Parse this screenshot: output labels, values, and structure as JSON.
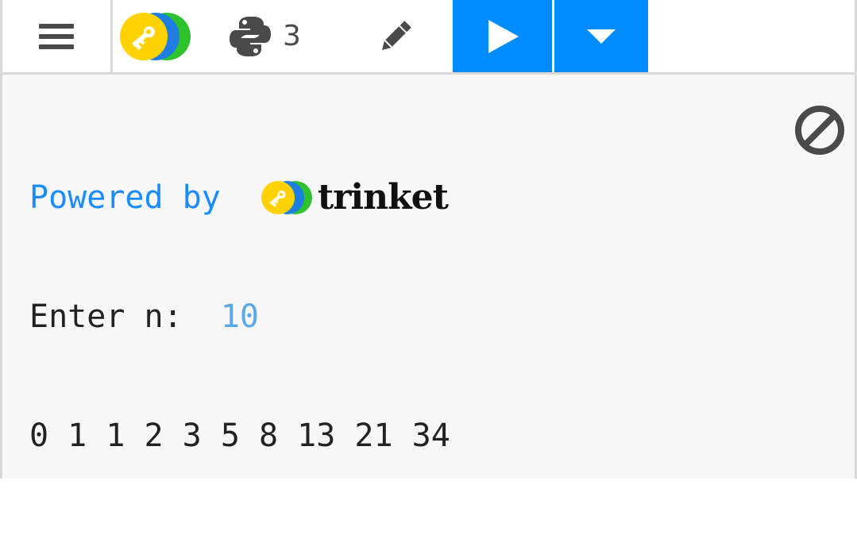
{
  "toolbar": {
    "menu_icon": "hamburger-menu-icon",
    "logo_icon": "trinket-key-logo",
    "python_icon": "python-icon",
    "python_version": "3",
    "edit_icon": "pencil-icon",
    "run_icon": "play-icon",
    "dropdown_icon": "caret-down-icon",
    "accent_color": "#008cff"
  },
  "output": {
    "powered_by_label": "Powered by ",
    "brand_name": "trinket",
    "prompt_text": "Enter n:  ",
    "input_value": "10",
    "result_line": "0 1 1 2 3 5 8 13 21 34",
    "clear_icon": "no-entry-icon"
  }
}
